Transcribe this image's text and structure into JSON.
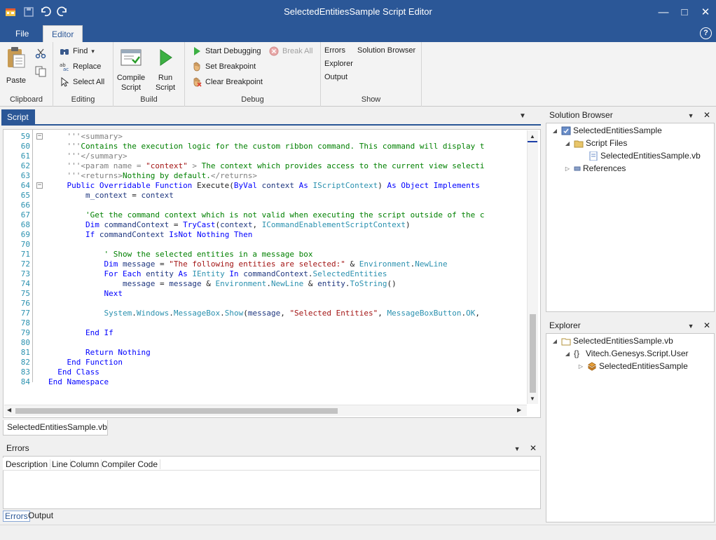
{
  "window": {
    "title": "SelectedEntitiesSample Script Editor"
  },
  "menu": {
    "tabs": [
      "File",
      "Editor"
    ],
    "help_label": "?"
  },
  "ribbon": {
    "clipboard": {
      "label": "Clipboard",
      "paste": "Paste"
    },
    "editing": {
      "label": "Editing",
      "find": "Find",
      "replace": "Replace",
      "select_all": "Select All"
    },
    "build": {
      "label": "Build",
      "compile": [
        "Compile",
        "Script"
      ],
      "run": [
        "Run",
        "Script"
      ]
    },
    "debug": {
      "label": "Debug",
      "start": "Start Debugging",
      "break_all": "Break All",
      "set_bp": "Set Breakpoint",
      "clear_bp": "Clear Breakpoint"
    },
    "show": {
      "label": "Show",
      "errors": "Errors",
      "solution_browser": "Solution Browser",
      "explorer": "Explorer",
      "output": "Output"
    }
  },
  "editor": {
    "tab": "Script",
    "document_tab": "SelectedEntitiesSample.vb",
    "lines": [
      {
        "n": "59",
        "fold": "minus",
        "parts": [
          [
            "gr",
            "'''<summary>"
          ]
        ]
      },
      {
        "n": "60",
        "parts": [
          [
            "gr",
            "'''"
          ],
          [
            "cm",
            "Contains the execution logic for the custom ribbon command. This command will display t"
          ]
        ]
      },
      {
        "n": "61",
        "parts": [
          [
            "gr",
            "'''</summary>"
          ]
        ]
      },
      {
        "n": "62",
        "parts": [
          [
            "gr",
            "'''<param name = "
          ],
          [
            "st",
            "\"context\""
          ],
          [
            "gr",
            " >"
          ],
          [
            "cm",
            " The context which provides access to the current view selecti"
          ]
        ]
      },
      {
        "n": "63",
        "parts": [
          [
            "gr",
            "'''<returns>"
          ],
          [
            "cm",
            "Nothing by default."
          ],
          [
            "gr",
            "</returns>"
          ]
        ]
      },
      {
        "n": "64",
        "fold": "minus",
        "parts": [
          [
            "kw",
            "Public Overridable Function "
          ],
          [
            "txt",
            "Execute("
          ],
          [
            "kw",
            "ByVal "
          ],
          [
            "id",
            "context "
          ],
          [
            "kw",
            "As "
          ],
          [
            "ty",
            "IScriptContext"
          ],
          [
            "txt",
            ") "
          ],
          [
            "kw",
            "As Object Implements"
          ]
        ]
      },
      {
        "n": "65",
        "parts": [
          [
            "txt",
            "    "
          ],
          [
            "id",
            "m_context"
          ],
          [
            "txt",
            " = "
          ],
          [
            "id",
            "context"
          ]
        ]
      },
      {
        "n": "66",
        "parts": []
      },
      {
        "n": "67",
        "parts": [
          [
            "txt",
            "    "
          ],
          [
            "cm",
            "'Get the command context which is not valid when executing the script outside of the c"
          ]
        ]
      },
      {
        "n": "68",
        "parts": [
          [
            "txt",
            "    "
          ],
          [
            "kw",
            "Dim "
          ],
          [
            "id",
            "commandContext"
          ],
          [
            "txt",
            " = "
          ],
          [
            "kw",
            "TryCast"
          ],
          [
            "txt",
            "("
          ],
          [
            "id",
            "context"
          ],
          [
            "txt",
            ", "
          ],
          [
            "ty",
            "ICommandEnablementScriptContext"
          ],
          [
            "txt",
            ")"
          ]
        ]
      },
      {
        "n": "69",
        "parts": [
          [
            "txt",
            "    "
          ],
          [
            "kw",
            "If "
          ],
          [
            "id",
            "commandContext "
          ],
          [
            "kw",
            "IsNot Nothing Then"
          ]
        ]
      },
      {
        "n": "70",
        "parts": []
      },
      {
        "n": "71",
        "parts": [
          [
            "txt",
            "        "
          ],
          [
            "cm",
            "' Show the selected entities in a message box"
          ]
        ]
      },
      {
        "n": "72",
        "parts": [
          [
            "txt",
            "        "
          ],
          [
            "kw",
            "Dim "
          ],
          [
            "id",
            "message"
          ],
          [
            "txt",
            " = "
          ],
          [
            "st",
            "\"The following entities are selected:\""
          ],
          [
            "txt",
            " & "
          ],
          [
            "ty",
            "Environment"
          ],
          [
            "txt",
            "."
          ],
          [
            "ty",
            "NewLine"
          ]
        ]
      },
      {
        "n": "73",
        "parts": [
          [
            "txt",
            "        "
          ],
          [
            "kw",
            "For Each "
          ],
          [
            "id",
            "entity "
          ],
          [
            "kw",
            "As "
          ],
          [
            "ty",
            "IEntity "
          ],
          [
            "kw",
            "In "
          ],
          [
            "id",
            "commandContext"
          ],
          [
            "txt",
            "."
          ],
          [
            "ty",
            "SelectedEntities"
          ]
        ]
      },
      {
        "n": "74",
        "parts": [
          [
            "txt",
            "            "
          ],
          [
            "id",
            "message"
          ],
          [
            "txt",
            " = "
          ],
          [
            "id",
            "message"
          ],
          [
            "txt",
            " & "
          ],
          [
            "ty",
            "Environment"
          ],
          [
            "txt",
            "."
          ],
          [
            "ty",
            "NewLine"
          ],
          [
            "txt",
            " & "
          ],
          [
            "id",
            "entity"
          ],
          [
            "txt",
            "."
          ],
          [
            "ty",
            "ToString"
          ],
          [
            "txt",
            "()"
          ]
        ]
      },
      {
        "n": "75",
        "parts": [
          [
            "txt",
            "        "
          ],
          [
            "kw",
            "Next"
          ]
        ]
      },
      {
        "n": "76",
        "parts": []
      },
      {
        "n": "77",
        "parts": [
          [
            "txt",
            "        "
          ],
          [
            "ty",
            "System"
          ],
          [
            "txt",
            "."
          ],
          [
            "ty",
            "Windows"
          ],
          [
            "txt",
            "."
          ],
          [
            "ty",
            "MessageBox"
          ],
          [
            "txt",
            "."
          ],
          [
            "ty",
            "Show"
          ],
          [
            "txt",
            "("
          ],
          [
            "id",
            "message"
          ],
          [
            "txt",
            ", "
          ],
          [
            "st",
            "\"Selected Entities\""
          ],
          [
            "txt",
            ", "
          ],
          [
            "ty",
            "MessageBoxButton"
          ],
          [
            "txt",
            "."
          ],
          [
            "ty",
            "OK"
          ],
          [
            "txt",
            ","
          ]
        ]
      },
      {
        "n": "78",
        "parts": []
      },
      {
        "n": "79",
        "parts": [
          [
            "txt",
            "    "
          ],
          [
            "kw",
            "End If"
          ]
        ]
      },
      {
        "n": "80",
        "parts": []
      },
      {
        "n": "81",
        "parts": [
          [
            "txt",
            "    "
          ],
          [
            "kw",
            "Return Nothing"
          ]
        ]
      },
      {
        "n": "82",
        "parts": [
          [
            "kw",
            "End Function"
          ]
        ]
      },
      {
        "n": "83",
        "parts": [
          [
            "kw",
            "End Class"
          ]
        ]
      },
      {
        "n": "84",
        "parts": [
          [
            "kw",
            "End Namespace"
          ]
        ]
      }
    ]
  },
  "solution_browser": {
    "title": "Solution Browser",
    "root": "SelectedEntitiesSample",
    "script_files": "Script Files",
    "file": "SelectedEntitiesSample.vb",
    "references": "References"
  },
  "explorer": {
    "title": "Explorer",
    "file": "SelectedEntitiesSample.vb",
    "namespace": "Vitech.Genesys.Script.User",
    "class": "SelectedEntitiesSample"
  },
  "errors_panel": {
    "title": "Errors",
    "columns": [
      "Description",
      "Line",
      "Column",
      "Compiler Code"
    ],
    "tabs": [
      "Errors",
      "Output"
    ]
  },
  "colors": {
    "accent": "#2b5797",
    "keyword": "#0000ff",
    "comment": "#008000",
    "type": "#2b91af",
    "string": "#a31515"
  }
}
